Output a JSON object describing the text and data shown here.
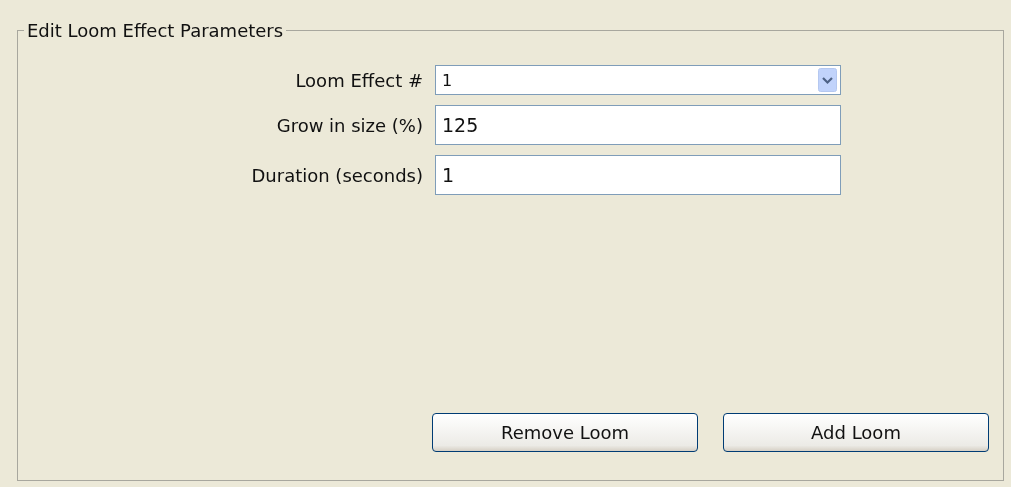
{
  "group": {
    "title": "Edit Loom Effect Parameters"
  },
  "fields": [
    {
      "label": "Loom Effect #",
      "kind": "dropdown",
      "value": "1"
    },
    {
      "label": "Grow in size (%)",
      "kind": "text",
      "value": "125"
    },
    {
      "label": "Duration (seconds)",
      "kind": "text",
      "value": "1"
    }
  ],
  "buttons": [
    "Remove Loom",
    "Add Loom"
  ]
}
